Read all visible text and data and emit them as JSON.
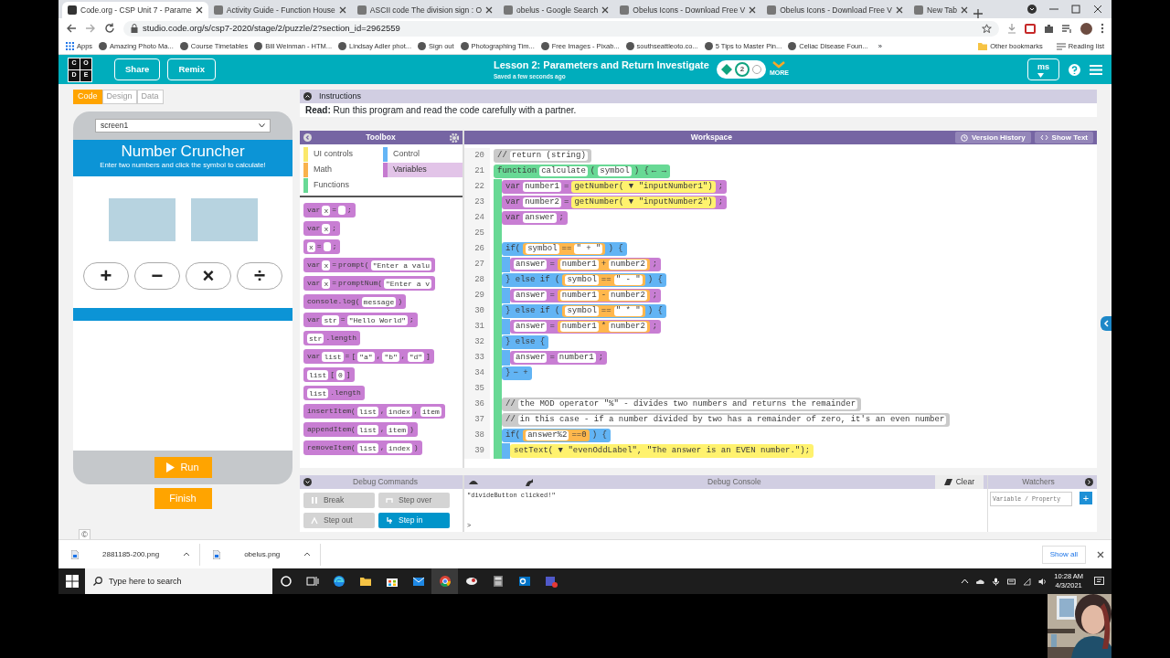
{
  "browser": {
    "tabs": [
      {
        "title": "Code.org - CSP Unit 7 - Parame",
        "selected": true
      },
      {
        "title": "Activity Guide - Function House",
        "selected": false
      },
      {
        "title": "ASCII code The division sign : O",
        "selected": false
      },
      {
        "title": "obelus - Google Search",
        "selected": false
      },
      {
        "title": "Obelus Icons - Download Free V",
        "selected": false
      },
      {
        "title": "Obelus Icons - Download Free V",
        "selected": false
      },
      {
        "title": "New Tab",
        "selected": false
      }
    ],
    "address": "studio.code.org/s/csp7-2020/stage/2/puzzle/2?section_id=2962559",
    "bookmarks": [
      {
        "label": "Apps",
        "kind": "apps"
      },
      {
        "label": "Amazing Photo Ma...",
        "kind": "site"
      },
      {
        "label": "Course Timetables",
        "kind": "site"
      },
      {
        "label": "Bill Weinman - HTM...",
        "kind": "site"
      },
      {
        "label": "Lindsay Adler phot...",
        "kind": "site"
      },
      {
        "label": "Sign out",
        "kind": "site"
      },
      {
        "label": "Photographing Tim...",
        "kind": "site"
      },
      {
        "label": "Free Images - Pixab...",
        "kind": "site"
      },
      {
        "label": "southseattleoto.co...",
        "kind": "site"
      },
      {
        "label": "5 Tips to Master Pin...",
        "kind": "site"
      },
      {
        "label": "Celiac Disease Foun...",
        "kind": "site"
      }
    ],
    "bookmarks_overflow": "»",
    "other_bookmarks": [
      {
        "label": "Other bookmarks",
        "kind": "folder"
      },
      {
        "label": "Reading list",
        "kind": "reading"
      }
    ]
  },
  "header": {
    "logo": [
      "C",
      "O",
      "D",
      "E"
    ],
    "buttons": [
      "Share",
      "Remix"
    ],
    "lesson_title": "Lesson 2: Parameters and Return Investigate",
    "saved": "Saved a few seconds ago",
    "progress": [
      {
        "kind": "diamond",
        "selected": false
      },
      {
        "kind": "bubble",
        "label": "2",
        "selected": true
      },
      {
        "kind": "bubble",
        "selected": false
      }
    ],
    "more": "MORE",
    "user": "ms"
  },
  "app_panel": {
    "modes": [
      {
        "label": "Code",
        "selected": true
      },
      {
        "label": "Design",
        "selected": false
      },
      {
        "label": "Data",
        "selected": false
      }
    ],
    "screen": "screen1",
    "app_title": "Number Cruncher",
    "app_subtitle": "Enter two numbers and click the symbol to calculate!",
    "operators": [
      "+",
      "−",
      "×",
      "÷"
    ],
    "run": "Run",
    "finish": "Finish",
    "copyright": "©"
  },
  "instructions": {
    "title": "Instructions",
    "text": "**Read:** Run this program and read the code carefully with a partner."
  },
  "toolbox": {
    "title": "Toolbox",
    "categories": [
      {
        "label": "UI controls",
        "color": "#fbe86b",
        "selected": false
      },
      {
        "label": "Control",
        "color": "#64b5f6",
        "selected": false
      },
      {
        "label": "Math",
        "color": "#f9b24c",
        "selected": false
      },
      {
        "label": "Variables",
        "color": "#c67bd0",
        "selected": true
      },
      {
        "label": "Functions",
        "color": "#68d995",
        "selected": false
      }
    ],
    "blocks": [
      [
        {
          "kind": "kw",
          "text": "var"
        },
        {
          "kind": "slot",
          "text": "x"
        },
        {
          "kind": "kw",
          "text": "="
        },
        {
          "kind": "hole"
        },
        {
          "kind": "kw",
          "text": ";"
        }
      ],
      [
        {
          "kind": "kw",
          "text": "var"
        },
        {
          "kind": "slot",
          "text": "x"
        },
        {
          "kind": "kw",
          "text": ";"
        }
      ],
      [
        {
          "kind": "slot",
          "text": "x"
        },
        {
          "kind": "kw",
          "text": "="
        },
        {
          "kind": "hole"
        },
        {
          "kind": "kw",
          "text": ";"
        }
      ],
      [
        {
          "kind": "kw",
          "text": "var"
        },
        {
          "kind": "slot",
          "text": "x"
        },
        {
          "kind": "kw",
          "text": "="
        },
        {
          "kind": "kw",
          "text": "prompt("
        },
        {
          "kind": "slot",
          "text": "\"Enter a valu"
        }
      ],
      [
        {
          "kind": "kw",
          "text": "var"
        },
        {
          "kind": "slot",
          "text": "x"
        },
        {
          "kind": "kw",
          "text": "="
        },
        {
          "kind": "kw",
          "text": "promptNum("
        },
        {
          "kind": "slot",
          "text": "\"Enter a v"
        }
      ],
      [
        {
          "kind": "kw",
          "text": "console.log("
        },
        {
          "kind": "slot",
          "text": "message"
        },
        {
          "kind": "kw",
          "text": ")"
        }
      ],
      [
        {
          "kind": "kw",
          "text": "var"
        },
        {
          "kind": "slot",
          "text": "str"
        },
        {
          "kind": "kw",
          "text": "="
        },
        {
          "kind": "slot",
          "text": "\"Hello World\""
        },
        {
          "kind": "kw",
          "text": ";"
        }
      ],
      [
        {
          "kind": "slot",
          "text": "str"
        },
        {
          "kind": "kw",
          "text": ".length"
        }
      ],
      [
        {
          "kind": "kw",
          "text": "var"
        },
        {
          "kind": "slot",
          "text": "list"
        },
        {
          "kind": "kw",
          "text": "="
        },
        {
          "kind": "kw",
          "text": "["
        },
        {
          "kind": "slot",
          "text": "\"a\""
        },
        {
          "kind": "kw",
          "text": ","
        },
        {
          "kind": "slot",
          "text": "\"b\""
        },
        {
          "kind": "kw",
          "text": ","
        },
        {
          "kind": "slot",
          "text": "\"d\""
        },
        {
          "kind": "kw",
          "text": "]"
        }
      ],
      [
        {
          "kind": "slot",
          "text": "list"
        },
        {
          "kind": "kw",
          "text": "["
        },
        {
          "kind": "slot",
          "text": "0"
        },
        {
          "kind": "kw",
          "text": "]"
        }
      ],
      [
        {
          "kind": "slot",
          "text": "list"
        },
        {
          "kind": "kw",
          "text": ".length"
        }
      ],
      [
        {
          "kind": "kw",
          "text": "insertItem("
        },
        {
          "kind": "slot",
          "text": "list"
        },
        {
          "kind": "kw",
          "text": ","
        },
        {
          "kind": "slot",
          "text": "index"
        },
        {
          "kind": "kw",
          "text": ","
        },
        {
          "kind": "slot",
          "text": "item"
        }
      ],
      [
        {
          "kind": "kw",
          "text": "appendItem("
        },
        {
          "kind": "slot",
          "text": "list"
        },
        {
          "kind": "kw",
          "text": ","
        },
        {
          "kind": "slot",
          "text": "item"
        },
        {
          "kind": "kw",
          "text": ")"
        }
      ],
      [
        {
          "kind": "kw",
          "text": "removeItem("
        },
        {
          "kind": "slot",
          "text": "list"
        },
        {
          "kind": "kw",
          "text": ","
        },
        {
          "kind": "slot",
          "text": "index"
        },
        {
          "kind": "kw",
          "text": ")"
        }
      ]
    ]
  },
  "workspace": {
    "title": "Workspace",
    "buttons": [
      {
        "label": "Version History",
        "kind": "history"
      },
      {
        "label": "Show Text",
        "kind": "text"
      }
    ],
    "lines": [
      {
        "number": "20",
        "kind": "comment",
        "parts": [
          {
            "kind": "kw",
            "text": "//"
          },
          {
            "kind": "slot",
            "text": "return (string)"
          }
        ]
      },
      {
        "number": "21",
        "kind": "function",
        "parts": [
          {
            "kind": "kw",
            "text": "function"
          },
          {
            "kind": "slot",
            "text": "calculate"
          },
          {
            "kind": "kw",
            "text": "("
          },
          {
            "kind": "slot",
            "text": "symbol"
          },
          {
            "kind": "kw",
            "text": ") {"
          },
          {
            "kind": "kw",
            "text": "← →"
          }
        ],
        "children": [
          {
            "number": "22",
            "kind": "var",
            "parts": [
              {
                "kind": "kw",
                "text": "var"
              },
              {
                "kind": "slot",
                "text": "number1"
              },
              {
                "kind": "kw",
                "text": "="
              },
              {
                "kind": "call",
                "text": "getNumber( ▼ \"inputNumber1\")"
              },
              {
                "kind": "kw",
                "text": ";"
              }
            ]
          },
          {
            "number": "23",
            "kind": "var",
            "parts": [
              {
                "kind": "kw",
                "text": "var"
              },
              {
                "kind": "slot",
                "text": "number2"
              },
              {
                "kind": "kw",
                "text": "="
              },
              {
                "kind": "call",
                "text": "getNumber( ▼ \"inputNumber2\")"
              },
              {
                "kind": "kw",
                "text": ";"
              }
            ]
          },
          {
            "number": "24",
            "kind": "var",
            "parts": [
              {
                "kind": "kw",
                "text": "var"
              },
              {
                "kind": "slot",
                "text": "answer"
              },
              {
                "kind": "kw",
                "text": ";"
              }
            ]
          },
          {
            "number": "25",
            "kind": "blank"
          },
          {
            "number": "26",
            "kind": "control",
            "parts": [
              {
                "kind": "kw",
                "text": "if("
              },
              {
                "kind": "expr",
                "parts": [
                  {
                    "kind": "slot",
                    "text": "symbol"
                  },
                  {
                    "kind": "kw",
                    "text": "=="
                  },
                  {
                    "kind": "slot",
                    "text": "\" + \""
                  }
                ]
              },
              {
                "kind": "kw",
                "text": ") {"
              }
            ],
            "children": [
              {
                "number": "27",
                "kind": "var",
                "parts": [
                  {
                    "kind": "slot",
                    "text": "answer"
                  },
                  {
                    "kind": "kw",
                    "text": "="
                  },
                  {
                    "kind": "expr",
                    "parts": [
                      {
                        "kind": "slot",
                        "text": "number1"
                      },
                      {
                        "kind": "kw",
                        "text": "+"
                      },
                      {
                        "kind": "slot",
                        "text": "number2"
                      }
                    ]
                  },
                  {
                    "kind": "kw",
                    "text": ";"
                  }
                ]
              }
            ]
          },
          {
            "number": "28",
            "kind": "control",
            "parts": [
              {
                "kind": "kw",
                "text": "} else if ("
              },
              {
                "kind": "expr",
                "parts": [
                  {
                    "kind": "slot",
                    "text": "symbol"
                  },
                  {
                    "kind": "kw",
                    "text": "=="
                  },
                  {
                    "kind": "slot",
                    "text": "\" - \""
                  }
                ]
              },
              {
                "kind": "kw",
                "text": ") {"
              }
            ],
            "children": [
              {
                "number": "29",
                "kind": "var",
                "parts": [
                  {
                    "kind": "slot",
                    "text": "answer"
                  },
                  {
                    "kind": "kw",
                    "text": "="
                  },
                  {
                    "kind": "expr",
                    "parts": [
                      {
                        "kind": "slot",
                        "text": "number1"
                      },
                      {
                        "kind": "kw",
                        "text": "-"
                      },
                      {
                        "kind": "slot",
                        "text": "number2"
                      }
                    ]
                  },
                  {
                    "kind": "kw",
                    "text": ";"
                  }
                ]
              }
            ]
          },
          {
            "number": "30",
            "kind": "control",
            "parts": [
              {
                "kind": "kw",
                "text": "} else if ("
              },
              {
                "kind": "expr",
                "parts": [
                  {
                    "kind": "slot",
                    "text": "symbol"
                  },
                  {
                    "kind": "kw",
                    "text": "=="
                  },
                  {
                    "kind": "slot",
                    "text": "\" * \""
                  }
                ]
              },
              {
                "kind": "kw",
                "text": ") {"
              }
            ],
            "children": [
              {
                "number": "31",
                "kind": "var",
                "parts": [
                  {
                    "kind": "slot",
                    "text": "answer"
                  },
                  {
                    "kind": "kw",
                    "text": "="
                  },
                  {
                    "kind": "expr",
                    "parts": [
                      {
                        "kind": "slot",
                        "text": "number1"
                      },
                      {
                        "kind": "kw",
                        "text": "*"
                      },
                      {
                        "kind": "slot",
                        "text": "number2"
                      }
                    ]
                  },
                  {
                    "kind": "kw",
                    "text": ";"
                  }
                ]
              }
            ]
          },
          {
            "number": "32",
            "kind": "control",
            "parts": [
              {
                "kind": "kw",
                "text": "} else {"
              }
            ],
            "children": [
              {
                "number": "33",
                "kind": "var",
                "parts": [
                  {
                    "kind": "slot",
                    "text": "answer"
                  },
                  {
                    "kind": "kw",
                    "text": "="
                  },
                  {
                    "kind": "slot",
                    "text": "number1"
                  },
                  {
                    "kind": "kw",
                    "text": ";"
                  }
                ]
              }
            ]
          },
          {
            "number": "34",
            "kind": "control",
            "parts": [
              {
                "kind": "kw",
                "text": "}"
              },
              {
                "kind": "kw",
                "text": "− +"
              }
            ]
          },
          {
            "number": "35",
            "kind": "blank"
          },
          {
            "number": "36",
            "kind": "comment",
            "parts": [
              {
                "kind": "kw",
                "text": "//"
              },
              {
                "kind": "slot",
                "text": "the MOD operator \"%\" - divides two numbers and returns the remainder"
              }
            ]
          },
          {
            "number": "37",
            "kind": "comment",
            "parts": [
              {
                "kind": "kw",
                "text": "//"
              },
              {
                "kind": "slot",
                "text": "in this case - if a number divided by two has a remainder of zero, it's an even number"
              }
            ]
          },
          {
            "number": "38",
            "kind": "control",
            "parts": [
              {
                "kind": "kw",
                "text": "if("
              },
              {
                "kind": "expr",
                "parts": [
                  {
                    "kind": "slot",
                    "text": "answer%2"
                  },
                  {
                    "kind": "kw",
                    "text": "==0"
                  }
                ]
              },
              {
                "kind": "kw",
                "text": ") {"
              }
            ],
            "children": [
              {
                "number": "39",
                "kind": "call",
                "parts": [
                  {
                    "kind": "kw",
                    "text": "setText( ▼ \"evenOddLabel\", \"The answer is an EVEN number.\");"
                  }
                ]
              }
            ]
          }
        ]
      }
    ]
  },
  "debug": {
    "title": "Debug Commands",
    "buttons": [
      {
        "label": "Break",
        "kind": "pause",
        "disabled": true
      },
      {
        "label": "Step over",
        "kind": "over",
        "disabled": true
      },
      {
        "label": "Step out",
        "kind": "out",
        "disabled": true
      },
      {
        "label": "Step in",
        "kind": "in",
        "disabled": false
      }
    ],
    "console_title": "Debug Console",
    "clear": "Clear",
    "output": [
      "\"divideButton clicked!\""
    ],
    "prompt": ">",
    "watchers_title": "Watchers",
    "watch_placeholder": "Variable / Property",
    "add": "+"
  },
  "downloads": {
    "files": [
      "2881185-200.png",
      "obelus.png"
    ],
    "show_all": "Show all"
  },
  "taskbar": {
    "search_placeholder": "Type here to search",
    "time": "10:28 AM",
    "date": "4/3/2021"
  }
}
